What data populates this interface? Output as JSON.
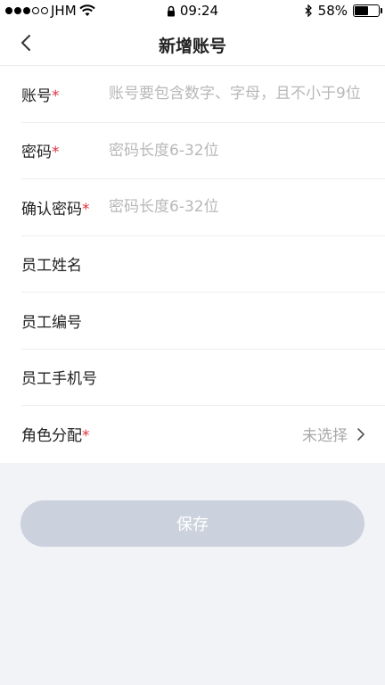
{
  "status_bar": {
    "carrier": "JHM",
    "time": "09:24",
    "battery": "58%",
    "battery_level": 0.58
  },
  "header": {
    "title": "新增账号"
  },
  "form": {
    "account": {
      "label": "账号",
      "placeholder": "账号要包含数字、字母，且不小于9位",
      "required_mark": "*"
    },
    "password": {
      "label": "密码",
      "placeholder": "密码长度6-32位",
      "required_mark": "*"
    },
    "confirm_password": {
      "label": "确认密码",
      "placeholder": "密码长度6-32位",
      "required_mark": "*"
    },
    "employee_name": {
      "label": "员工姓名"
    },
    "employee_id": {
      "label": "员工编号"
    },
    "employee_phone": {
      "label": "员工手机号"
    },
    "role": {
      "label": "角色分配",
      "required_mark": "*",
      "value": "未选择"
    }
  },
  "actions": {
    "save_label": "保存"
  },
  "colors": {
    "required": "#e0323c",
    "button_disabled": "#ccd2dd",
    "background": "#f2f3f7"
  }
}
